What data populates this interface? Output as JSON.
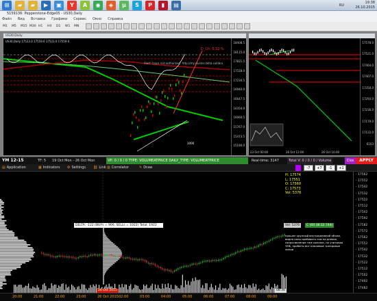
{
  "os": {
    "clock_time": "19:38",
    "clock_date": "26.10.2015",
    "lang": "RU"
  },
  "taskbar_icons": [
    {
      "name": "windows-start-icon",
      "color": "#2d7bd6",
      "glyph": "⊞"
    },
    {
      "name": "folder-icon",
      "color": "#e2b33a",
      "glyph": "▰"
    },
    {
      "name": "folder-icon",
      "color": "#e2b33a",
      "glyph": "▰"
    },
    {
      "name": "media-player-icon",
      "color": "#2a6fb5",
      "glyph": "▶"
    },
    {
      "name": "desktop-icon",
      "color": "#3b8fd8",
      "glyph": "▣"
    },
    {
      "name": "yandex-browser-icon",
      "color": "#e7382b",
      "glyph": "Y"
    },
    {
      "name": "android-icon",
      "color": "#8ac43a",
      "glyph": "A"
    },
    {
      "name": "chrome-icon",
      "color": "#3aa856",
      "glyph": "◉"
    },
    {
      "name": "app-icon",
      "color": "#e25e2a",
      "glyph": "◈"
    },
    {
      "name": "utorrent-icon",
      "color": "#5cb85c",
      "glyph": "μ"
    },
    {
      "name": "skype-icon",
      "color": "#1aa1e0",
      "glyph": "S"
    },
    {
      "name": "app-icon",
      "color": "#d8232a",
      "glyph": "P"
    },
    {
      "name": "app-icon",
      "color": "#b5152b",
      "glyph": "▮"
    },
    {
      "name": "mt4-icon",
      "color": "#3a6ea5",
      "glyph": "▤"
    }
  ],
  "window": {
    "title": "5159136: Pepperstone-Edge05 - US30,Daily",
    "menu": [
      "Файл",
      "Вид",
      "Вставка",
      "Графики",
      "Сервис",
      "Окно",
      "Справка"
    ]
  },
  "toolbar": {
    "timeframes": [
      "M1",
      "M5",
      "M15",
      "M30",
      "H1",
      "H4",
      "D1",
      "W1",
      "MN"
    ]
  },
  "chart1": {
    "title": "US30,Daily",
    "ohlc": "US30,Daily 17523.0 17559.0 17523.0 17559.0",
    "overlay_text": "Alert: trace not authorized. http://my.cluster.delta.collibra",
    "dc_text": "D_Ch: 0.32 %",
    "label_1000": "1000",
    "prices": [
      "18408.5",
      "18115.0",
      "17821.5",
      "17528.0",
      "17234.5",
      "16940.0",
      "16647.5",
      "16354.0",
      "16060.5",
      "15767.0",
      "15473.5",
      "15180.0"
    ]
  },
  "chart2": {
    "title": "",
    "prices": [
      "17578.0",
      "17521.0",
      "17464.0",
      "17407.0",
      "17350.0",
      "17293.0",
      "17236.0",
      "17179.0",
      "17122.0",
      "6103"
    ],
    "dates": [
      "23 Oct 00:00",
      "26 Oct 12:00",
      "26 Oct 16:00"
    ]
  },
  "lower": {
    "instrument": "YM 12-15",
    "tf": "TF: 5",
    "date_range": "19 Oct Mon - 26 Oct Mon",
    "vp_text": "VP: 0 / 0 / 0 TYPE: VOLUMEATPRICE DAILY_TYPE: VOLUMEATPRICE",
    "realtime": "Real-time: 3147",
    "total": "Total V: 0 / 0 / 0 / Volume",
    "close_label": "Clos",
    "apply_label": "APPLY",
    "tools": [
      "Application",
      "Indicators",
      "Settings",
      "Link",
      "Correlator",
      "Draw"
    ],
    "stepper": [
      "-7",
      "+7",
      "-1",
      "+1"
    ],
    "ohlc": {
      "h": "H: 17574",
      "l": "L: 17551",
      "o": "O: 17560",
      "c": "C: 17573",
      "vol": "Vol: 5376"
    },
    "delta_box": "DELTA: -122 (BUYs = 900, SELLs = 1022) Total: 1922",
    "vol_box": "Vol: 5376",
    "timer_box": "C (00:38:22.744)",
    "note": "прошел крупный внутридневной объем, видно кали пробивать сам на дневке, сопротивление там сильное, но учитывая YMK, пробиты все ключевые трендовые линии",
    "prices": [
      "17562",
      "17552",
      "17542",
      "17532",
      "17522",
      "17512",
      "17502",
      "17592",
      "17582",
      "17572",
      "17562",
      "17552",
      "17542",
      "17532",
      "17522",
      "17512",
      "17502",
      "17492",
      "17482"
    ],
    "times": [
      "20:00",
      "21:00",
      "22:00",
      "23:00",
      "26 Oct 2015",
      "02:00",
      "03:00",
      "04:00",
      "05:00",
      "06:00",
      "07:00",
      "08:00",
      "09:00"
    ],
    "date_label": "26 Oct 2015",
    "cursor_label": "08:30"
  }
}
